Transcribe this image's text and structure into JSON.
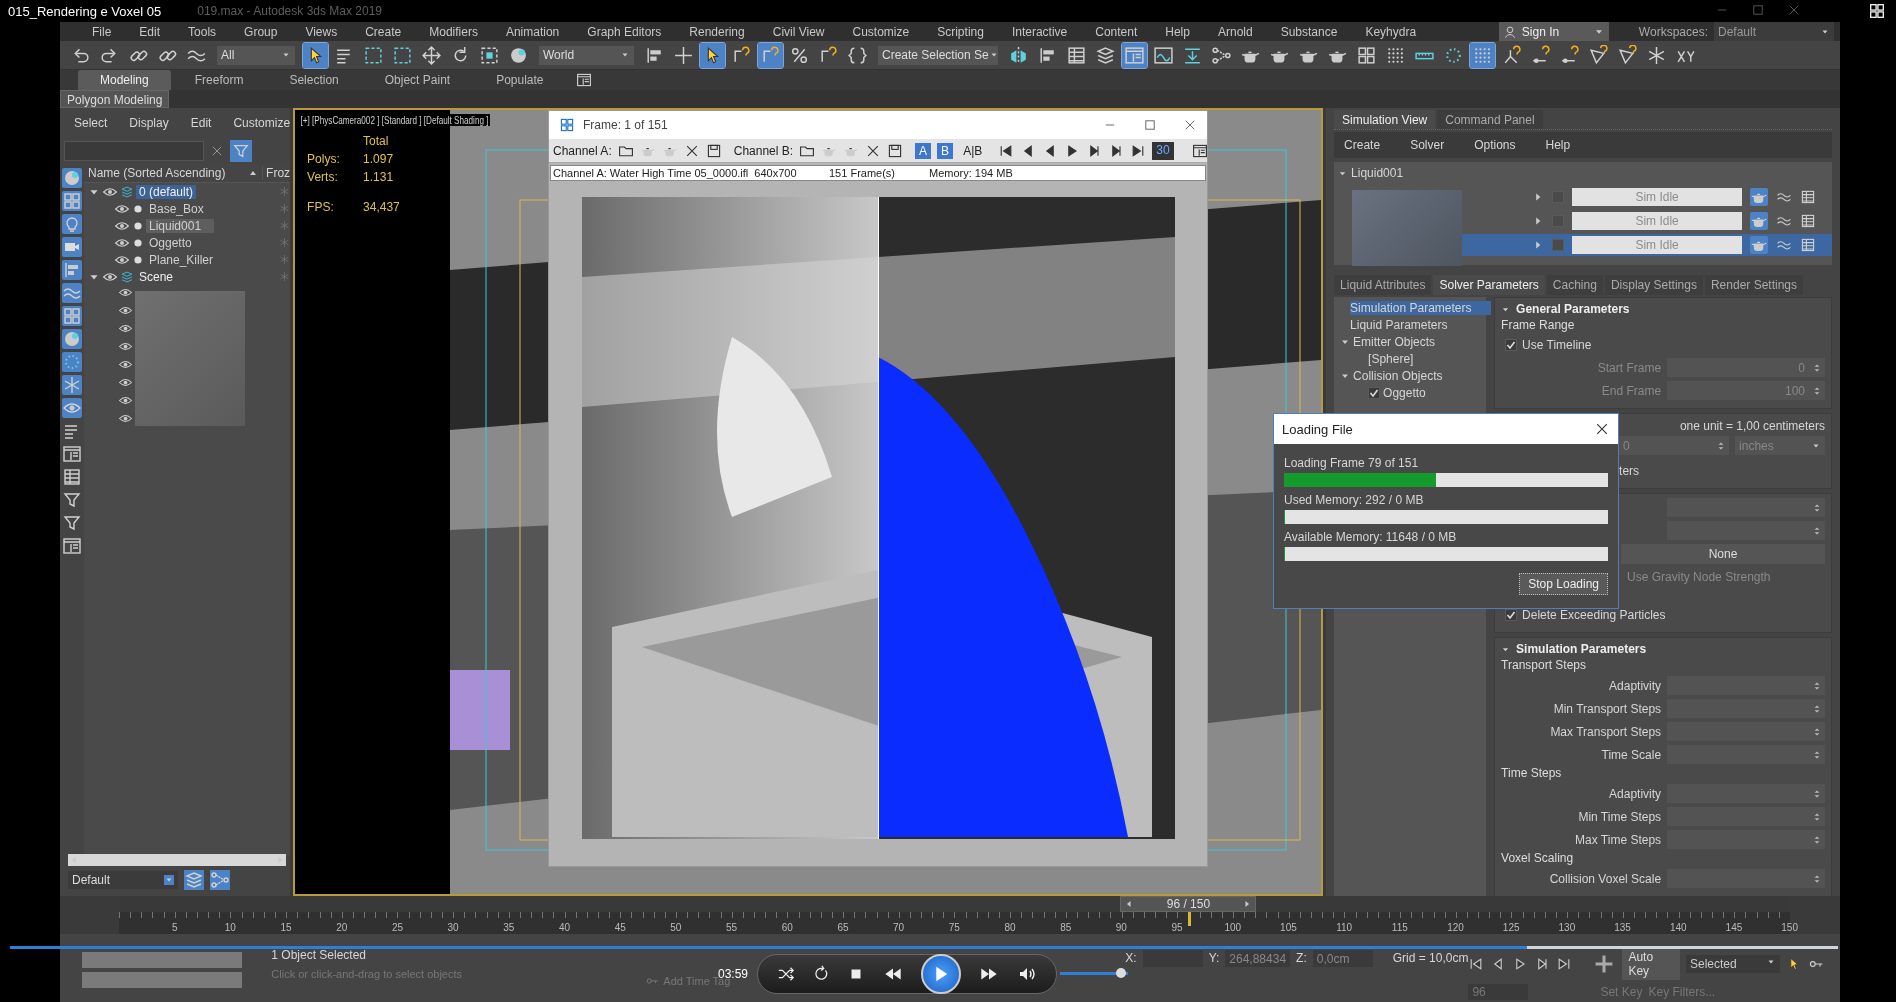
{
  "video": {
    "title": "015_Rendering e Voxel 05"
  },
  "app": {
    "title": "019.max - Autodesk 3ds Max 2019"
  },
  "menu": [
    "File",
    "Edit",
    "Tools",
    "Group",
    "Views",
    "Create",
    "Modifiers",
    "Animation",
    "Graph Editors",
    "Rendering",
    "Civil View",
    "Customize",
    "Scripting",
    "Interactive",
    "Content",
    "Help",
    "Arnold",
    "Substance",
    "Keyhydra"
  ],
  "account": {
    "label": "Sign In"
  },
  "workspaces": {
    "label": "Workspaces:",
    "value": "Default"
  },
  "toolbar": [
    {
      "kind": "button",
      "selected": false
    },
    {
      "kind": "button",
      "selected": false
    },
    {
      "kind": "button",
      "selected": false
    },
    {
      "kind": "button",
      "selected": false
    },
    {
      "kind": "button",
      "selected": false
    },
    {
      "kind": "dropdown",
      "value": "All"
    },
    {
      "kind": "button",
      "selected": true
    },
    {
      "kind": "button",
      "selected": false
    },
    {
      "kind": "button",
      "selected": false
    },
    {
      "kind": "button",
      "selected": false
    },
    {
      "kind": "button",
      "selected": false
    },
    {
      "kind": "button",
      "selected": false
    },
    {
      "kind": "button",
      "selected": false
    },
    {
      "kind": "button",
      "selected": false
    },
    {
      "kind": "dropdown",
      "value": "World"
    },
    {
      "kind": "button",
      "selected": false
    },
    {
      "kind": "button",
      "selected": false
    },
    {
      "kind": "button",
      "selected": true
    },
    {
      "kind": "button",
      "selected": false
    },
    {
      "kind": "button",
      "selected": true
    },
    {
      "kind": "button",
      "selected": false
    },
    {
      "kind": "button",
      "selected": false
    },
    {
      "kind": "button",
      "selected": false
    },
    {
      "kind": "dropdown",
      "value": "Create Selection Se"
    },
    {
      "kind": "button",
      "selected": false
    },
    {
      "kind": "button",
      "selected": false
    },
    {
      "kind": "button",
      "selected": false
    },
    {
      "kind": "button",
      "selected": false
    },
    {
      "kind": "button",
      "selected": true
    },
    {
      "kind": "button",
      "selected": false
    },
    {
      "kind": "button",
      "selected": false
    },
    {
      "kind": "button",
      "selected": false
    },
    {
      "kind": "button",
      "selected": false
    },
    {
      "kind": "button",
      "selected": false
    },
    {
      "kind": "button",
      "selected": false
    },
    {
      "kind": "button",
      "selected": false
    },
    {
      "kind": "button",
      "selected": false
    },
    {
      "kind": "button",
      "selected": false
    },
    {
      "kind": "button",
      "selected": false
    },
    {
      "kind": "button",
      "selected": false
    },
    {
      "kind": "button",
      "selected": true
    },
    {
      "kind": "button",
      "selected": false
    },
    {
      "kind": "button",
      "selected": false
    },
    {
      "kind": "button",
      "selected": false
    },
    {
      "kind": "button",
      "selected": false
    },
    {
      "kind": "button",
      "selected": false
    },
    {
      "kind": "button",
      "selected": false
    },
    {
      "kind": "button",
      "selected": false
    }
  ],
  "ribbon": {
    "tabs": [
      {
        "label": "Modeling",
        "selected": true
      },
      {
        "label": "Freeform",
        "selected": false
      },
      {
        "label": "Selection",
        "selected": false
      },
      {
        "label": "Object Paint",
        "selected": false
      },
      {
        "label": "Populate",
        "selected": false
      }
    ],
    "panel": "Polygon Modeling"
  },
  "explorer": {
    "menu": [
      "Select",
      "Display",
      "Edit",
      "Customize"
    ],
    "columns": [
      "Name (Sorted Ascending)",
      "Froz"
    ],
    "tree": [
      {
        "name": "0 (default)",
        "kind": "layer",
        "expanded": true,
        "selected": true,
        "children": [
          {
            "name": "Base_Box",
            "kind": "object",
            "selected": false
          },
          {
            "name": "Liquid001",
            "kind": "object",
            "selected": true
          },
          {
            "name": "Oggetto",
            "kind": "object",
            "selected": false
          },
          {
            "name": "Plane_Killer",
            "kind": "object",
            "selected": false
          }
        ]
      },
      {
        "name": "Scene",
        "kind": "layer",
        "expanded": true,
        "selected": false
      }
    ],
    "layer": "Default"
  },
  "viewport": {
    "label": "[+] [PhysCamera002 ] [Standard ] [Default Shading ]",
    "stats_header": "Total",
    "stats": [
      {
        "label": "Polys:",
        "value": "1.097"
      },
      {
        "label": "Verts:",
        "value": "1.131"
      },
      {
        "label": "FPS:",
        "value": "34,437"
      }
    ]
  },
  "frame_window": {
    "title": "Frame: 1 of 151",
    "channel_a": "Channel A:",
    "channel_b": "Channel B:",
    "channels": [
      {
        "label": "A",
        "selected": true
      },
      {
        "label": "B",
        "selected": true
      },
      {
        "label": "A|B",
        "selected": false
      }
    ],
    "zoom": "30",
    "info": [
      "Channel A: Water High Time 05_0000.ifl  640x700",
      "151 Frame(s)",
      "Memory: 194 MB"
    ]
  },
  "sim_panel": {
    "tabs": [
      {
        "label": "Simulation View",
        "selected": true
      },
      {
        "label": "Command Panel",
        "selected": false
      }
    ],
    "menu": [
      "Create",
      "Solver",
      "Options",
      "Help"
    ],
    "root": "Liquid001",
    "sims": [
      {
        "status": "Sim Idle",
        "selected": false
      },
      {
        "status": "Sim Idle",
        "selected": false
      },
      {
        "status": "Sim Idle",
        "selected": true
      }
    ],
    "param_tabs": [
      {
        "label": "Liquid Attributes",
        "selected": false
      },
      {
        "label": "Solver Parameters",
        "selected": true
      },
      {
        "label": "Caching",
        "selected": false
      },
      {
        "label": "Display Settings",
        "selected": false
      },
      {
        "label": "Render Settings",
        "selected": false
      }
    ],
    "nav": [
      {
        "label": "Simulation Parameters",
        "selected": true
      },
      {
        "label": "Liquid Parameters",
        "selected": false
      },
      {
        "label": "Emitter Objects",
        "selected": false,
        "expanded": true,
        "children": [
          {
            "label": "[Sphere]",
            "selected": false
          }
        ]
      },
      {
        "label": "Collision Objects",
        "selected": false,
        "expanded": true,
        "children": [
          {
            "label": "Oggetto",
            "selected": false,
            "checked": true
          }
        ]
      }
    ],
    "general": {
      "title": "General Parameters",
      "group": "Frame Range",
      "use_timeline": {
        "label": "Use Timeline",
        "checked": true
      },
      "fields": [
        {
          "label": "Start Frame",
          "value": "0",
          "disabled": true
        },
        {
          "label": "End Frame",
          "value": "100",
          "disabled": true
        }
      ],
      "unit_note": "one unit = 1,00 centimeters",
      "unit_value": "0",
      "unit_choice": "inches",
      "cut_label": "ters",
      "choice": "None",
      "options": [
        {
          "label": "Use Gravity Node Strength",
          "disabled": true
        },
        {
          "label": "Delete Exceeding Particles",
          "checked": true,
          "disabled": false
        }
      ]
    },
    "simulation": {
      "title": "Simulation Parameters",
      "groups": [
        {
          "title": "Transport Steps",
          "fields": [
            "Adaptivity",
            "Min Transport Steps",
            "Max Transport Steps",
            "Time Scale"
          ]
        },
        {
          "title": "Time Steps",
          "fields": [
            "Adaptivity",
            "Min Time Steps",
            "Max Time Steps"
          ]
        },
        {
          "title": "Voxel Scaling",
          "fields": [
            "Collision Voxel Scale"
          ]
        }
      ]
    }
  },
  "loading_dialog": {
    "title": "Loading File",
    "rows": [
      {
        "label": "Loading Frame 79 of 151",
        "level": 0.47
      },
      {
        "label": "Used Memory:  292 / 0 MB",
        "level": 0
      },
      {
        "label": "Available Memory:  11648 / 0 MB",
        "level": 0
      }
    ],
    "button": "Stop Loading"
  },
  "timeline": {
    "position": "96 / 150",
    "level": 0.64,
    "ticks": [
      "5",
      "10",
      "15",
      "20",
      "25",
      "30",
      "35",
      "40",
      "45",
      "50",
      "55",
      "60",
      "65",
      "70",
      "75",
      "80",
      "85",
      "90",
      "95",
      "100",
      "105",
      "110",
      "115",
      "120",
      "125",
      "130",
      "135",
      "140",
      "145",
      "150"
    ]
  },
  "status": {
    "selection": "1 Object Selected",
    "prompt": "Click or click-and-drag to select objects",
    "coords": [
      {
        "label": "X:"
      },
      {
        "label": "Y:",
        "value": "264,88434"
      },
      {
        "label": "Z:",
        "value": "0,0cm"
      }
    ],
    "grid": "Grid = 10,0cm",
    "time_tag": "Add Time Tag",
    "auto_key": "Auto Key",
    "key_mode": "Selected",
    "set_key": "Set Key",
    "key_filters": "Key Filters...",
    "frame": "96"
  },
  "player": {
    "time": "03:59",
    "seek": {
      "level": 0.83
    },
    "volume": {
      "level": 0.9
    }
  }
}
